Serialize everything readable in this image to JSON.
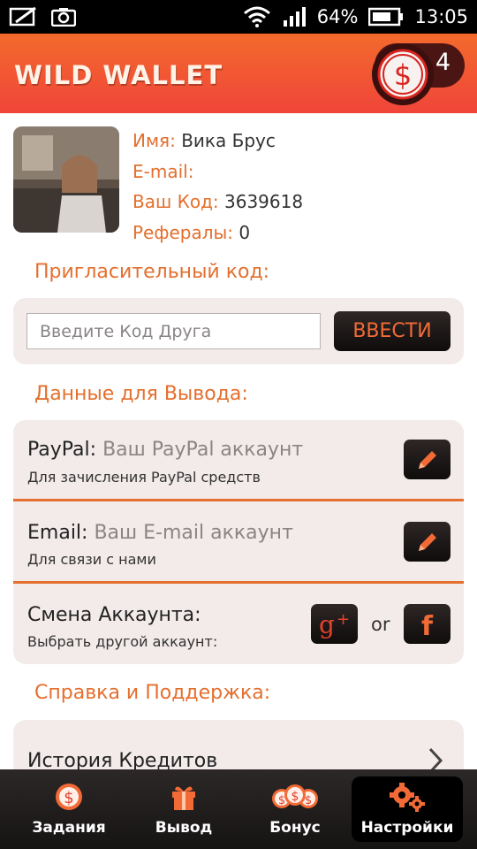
{
  "status_bar": {
    "battery": "64%",
    "time": "13:05"
  },
  "app": {
    "title": "WILD WALLET",
    "coins": "4",
    "brand_color": "#f0453a",
    "accent_color": "#e46f2e"
  },
  "profile": {
    "name_label": "Имя:",
    "name_value": "Вика Брус",
    "email_label": "E-mail:",
    "email_value": "",
    "code_label": "Ваш Код:",
    "code_value": "3639618",
    "referrals_label": "Рефералы:",
    "referrals_value": "0"
  },
  "invite": {
    "section_title": "Пригласительный код:",
    "placeholder": "Введите Код Друга",
    "button_label": "ВВЕСТИ"
  },
  "withdraw": {
    "section_title": "Данные для Вывода:",
    "paypal_label": "PayPal:",
    "paypal_hint": "Ваш PayPal аккаунт",
    "paypal_sub": "Для зачисления PayPal средств",
    "email_label": "Email:",
    "email_hint": "Ваш E-mail аккаунт",
    "email_sub": "Для связи с нами",
    "switch_label": "Смена Аккаунта:",
    "switch_sub": "Выбрать другой аккаунт:",
    "or_text": "or"
  },
  "support": {
    "section_title": "Справка и Поддержка:",
    "history_label": "История Кредитов"
  },
  "nav": {
    "items": [
      {
        "label": "Задания",
        "icon": "dollar-coin-icon"
      },
      {
        "label": "Вывод",
        "icon": "gift-icon"
      },
      {
        "label": "Бонус",
        "icon": "coins-stack-icon"
      },
      {
        "label": "Настройки",
        "icon": "gears-icon",
        "active": true
      }
    ]
  }
}
